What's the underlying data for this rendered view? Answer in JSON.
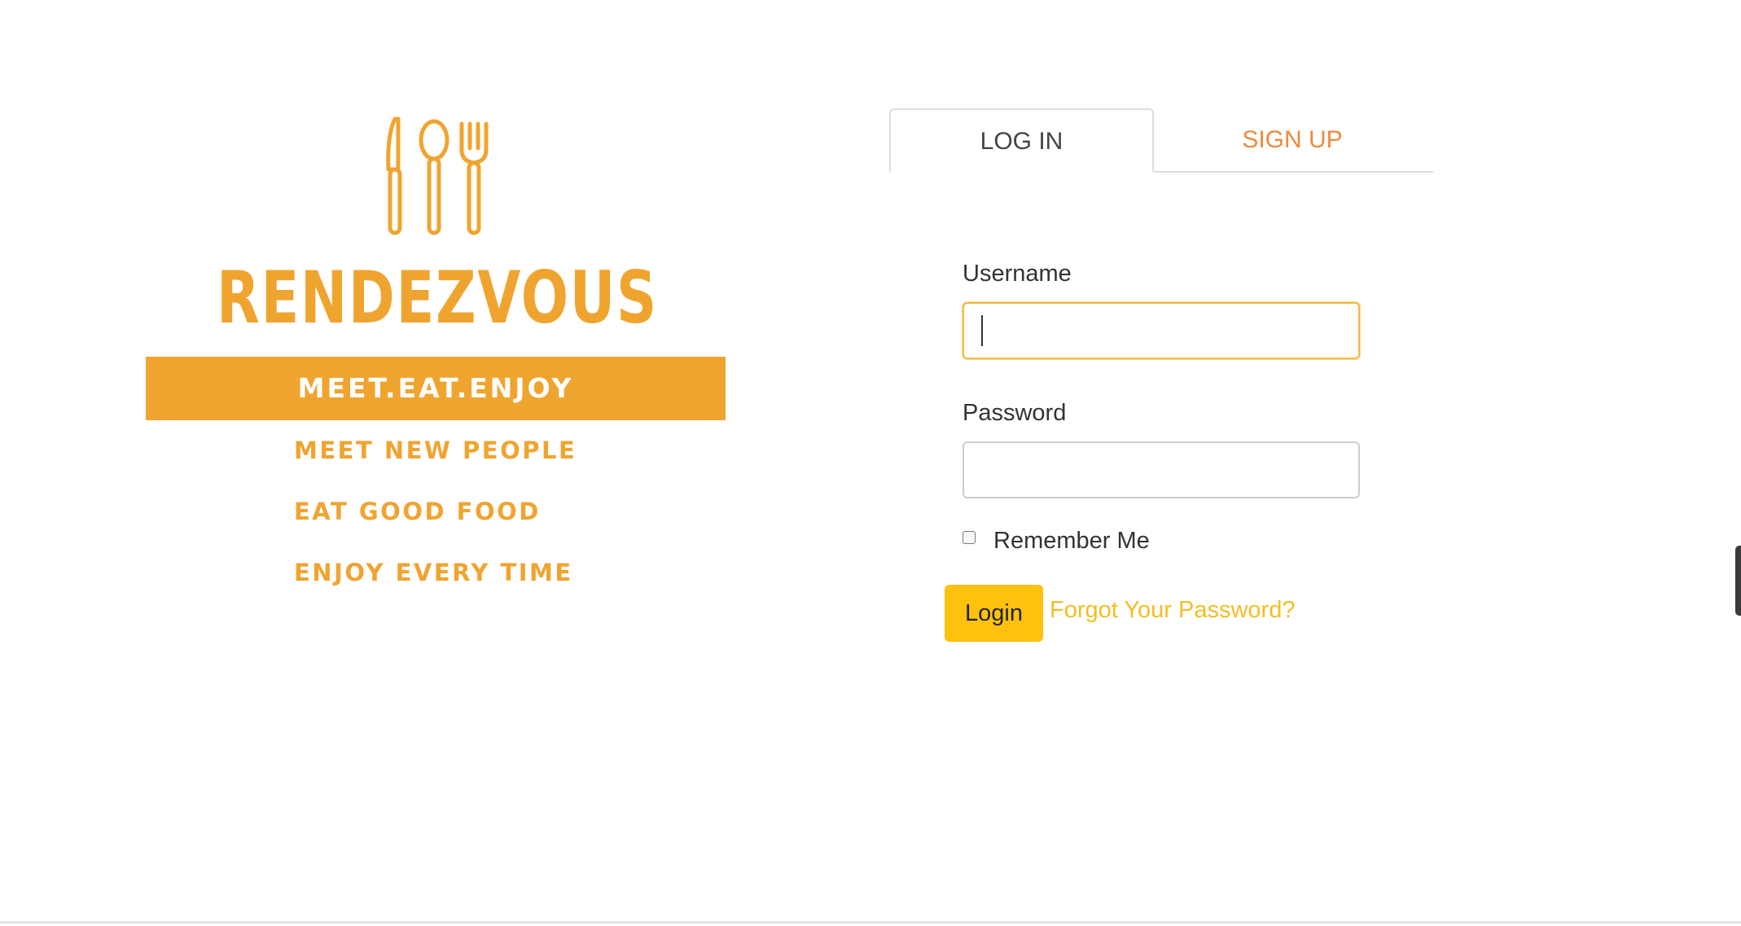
{
  "brand": {
    "name": "RENDEZVOUS",
    "slogan": "MEET.EAT.ENJOY",
    "taglines": [
      "MEET NEW PEOPLE",
      "EAT GOOD FOOD",
      "ENJOY EVERY TIME"
    ],
    "logo_icon": "cutlery-icon",
    "color": "#f0a430"
  },
  "tabs": [
    {
      "label": "LOG IN",
      "active": true
    },
    {
      "label": "SIGN UP",
      "active": false
    }
  ],
  "form": {
    "username_label": "Username",
    "username_value": "",
    "password_label": "Password",
    "password_value": "",
    "remember_label": "Remember Me",
    "remember_checked": false,
    "login_label": "Login",
    "forgot_label": "Forgot Your Password?"
  },
  "colors": {
    "accent": "#fdc10e",
    "link": "#f3be22",
    "signup_tab": "#ee8a3c",
    "focus_border": "#f5b942"
  }
}
